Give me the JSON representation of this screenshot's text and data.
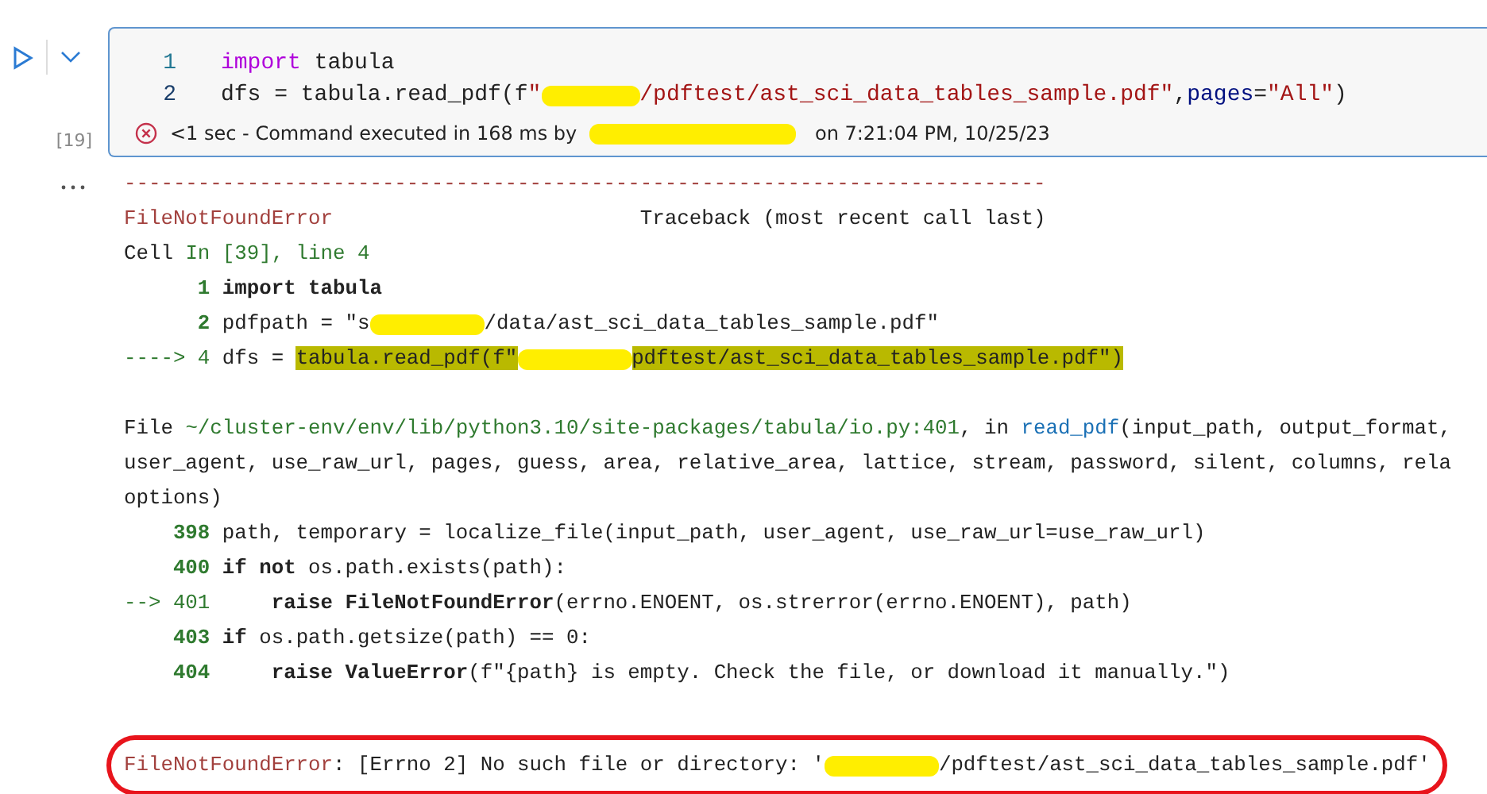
{
  "cell": {
    "execution_count": "[19]",
    "code_lines": [
      {
        "number": "1",
        "tokens": [
          {
            "kind": "kw",
            "text": "import"
          },
          {
            "kind": "text",
            "text": " tabula"
          }
        ]
      },
      {
        "number": "2",
        "tokens": [
          {
            "kind": "text",
            "text": "dfs = tabula.read_pdf(f"
          },
          {
            "kind": "str",
            "text": "\""
          },
          {
            "kind": "redaction"
          },
          {
            "kind": "str",
            "text": "/pdftest/ast_sci_data_tables_sample.pdf\""
          },
          {
            "kind": "text",
            "text": ","
          },
          {
            "kind": "param",
            "text": "pages"
          },
          {
            "kind": "text",
            "text": "="
          },
          {
            "kind": "str",
            "text": "\"All\""
          },
          {
            "kind": "text",
            "text": ")"
          }
        ]
      }
    ],
    "status": {
      "failed": true,
      "tokens": [
        {
          "kind": "text",
          "text": "<1 sec - Command executed in 168 ms by"
        },
        {
          "kind": "redaction"
        },
        {
          "kind": "text",
          "text": " on 7:21:04 PM, 10/25/23"
        }
      ]
    }
  },
  "output": {
    "lines": [
      {
        "kind": "code",
        "tokens": [
          {
            "kind": "err",
            "text": "---------------------------------------------------------------------------"
          }
        ]
      },
      {
        "kind": "code",
        "tokens": [
          {
            "kind": "err",
            "text": "FileNotFoundError"
          },
          {
            "kind": "text",
            "text": "                         Traceback (most recent call last)"
          }
        ]
      },
      {
        "kind": "code",
        "tokens": [
          {
            "kind": "text",
            "text": "Cell "
          },
          {
            "kind": "green",
            "text": "In [39], line 4"
          }
        ]
      },
      {
        "kind": "code",
        "tokens": [
          {
            "kind": "lineno",
            "text": "      1 "
          },
          {
            "kind": "bold",
            "text": "import"
          },
          {
            "kind": "bold",
            "text": " tabula"
          }
        ]
      },
      {
        "kind": "code",
        "tokens": [
          {
            "kind": "lineno",
            "text": "      2 "
          },
          {
            "kind": "text",
            "text": "pdfpath = \"s"
          },
          {
            "kind": "redaction"
          },
          {
            "kind": "text",
            "text": "/data/ast_sci_data_tables_sample.pdf\""
          }
        ]
      },
      {
        "kind": "code",
        "tokens": [
          {
            "kind": "green",
            "text": "----> 4 "
          },
          {
            "kind": "text",
            "text": "dfs = "
          },
          {
            "kind": "highlight",
            "text": "tabula.read_pdf(f\""
          },
          {
            "kind": "redaction"
          },
          {
            "kind": "highlight",
            "text": "pdftest/ast_sci_data_tables_sample.pdf\")"
          }
        ]
      },
      {
        "kind": "blank"
      },
      {
        "kind": "code",
        "tokens": [
          {
            "kind": "text",
            "text": "File "
          },
          {
            "kind": "green",
            "text": "~/cluster-env/env/lib/python3.10/site-packages/tabula/io.py:401"
          },
          {
            "kind": "text",
            "text": ", in "
          },
          {
            "kind": "func",
            "text": "read_pdf"
          },
          {
            "kind": "text",
            "text": "(input_path, output_format,"
          }
        ]
      },
      {
        "kind": "code",
        "tokens": [
          {
            "kind": "text",
            "text": "user_agent, use_raw_url, pages, guess, area, relative_area, lattice, stream, password, silent, columns, rela"
          }
        ]
      },
      {
        "kind": "code",
        "tokens": [
          {
            "kind": "text",
            "text": "options)"
          }
        ]
      },
      {
        "kind": "code",
        "tokens": [
          {
            "kind": "lineno",
            "text": "    398 "
          },
          {
            "kind": "text",
            "text": "path, temporary = localize_file(input_path, user_agent, use_raw_url=use_raw_url)"
          }
        ]
      },
      {
        "kind": "code",
        "tokens": [
          {
            "kind": "lineno",
            "text": "    400 "
          },
          {
            "kind": "bold",
            "text": "if not"
          },
          {
            "kind": "text",
            "text": " os.path.exists(path):"
          }
        ]
      },
      {
        "kind": "code",
        "tokens": [
          {
            "kind": "green",
            "text": "--> 401     "
          },
          {
            "kind": "bold",
            "text": "raise FileNotFoundError"
          },
          {
            "kind": "text",
            "text": "(errno.ENOENT, os.strerror(errno.ENOENT), path)"
          }
        ]
      },
      {
        "kind": "code",
        "tokens": [
          {
            "kind": "lineno",
            "text": "    403 "
          },
          {
            "kind": "bold",
            "text": "if"
          },
          {
            "kind": "text",
            "text": " os.path.getsize(path) == 0:"
          }
        ]
      },
      {
        "kind": "code",
        "tokens": [
          {
            "kind": "lineno",
            "text": "    404     "
          },
          {
            "kind": "bold",
            "text": "raise ValueError"
          },
          {
            "kind": "text",
            "text": "(f\"{path} is empty. Check the file, or download it manually.\")"
          }
        ]
      },
      {
        "kind": "blank"
      }
    ],
    "error_line": {
      "outlined": true,
      "tokens": [
        {
          "kind": "err",
          "text": "FileNotFoundError"
        },
        {
          "kind": "text",
          "text": ": [Errno 2] No such file or directory: '"
        },
        {
          "kind": "redaction"
        },
        {
          "kind": "text",
          "text": "/pdftest/ast_sci_data_tables_sample.pdf'"
        }
      ]
    }
  }
}
